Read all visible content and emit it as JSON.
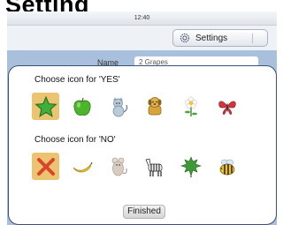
{
  "page": {
    "heading": "Setting"
  },
  "status_bar": {
    "time": "12:40"
  },
  "toolbar": {
    "settings_label": "Settings"
  },
  "background_form": {
    "name_label": "Name",
    "name_value": "2 Grapes"
  },
  "dialog": {
    "yes_prompt": "Choose icon for 'YES'",
    "no_prompt": "Choose icon for 'NO'",
    "yes_icons": [
      "star",
      "apple",
      "cat",
      "dog",
      "flower",
      "butterfly"
    ],
    "no_icons": [
      "cross",
      "banana",
      "mouse",
      "zebra",
      "leaf",
      "bee"
    ],
    "yes_selected": "star",
    "no_selected": "cross",
    "finished_label": "Finished"
  },
  "colors": {
    "selected_tile": "#ebc371",
    "dialog_border": "#3b4f74",
    "blue_band": "#a9c0dd"
  }
}
